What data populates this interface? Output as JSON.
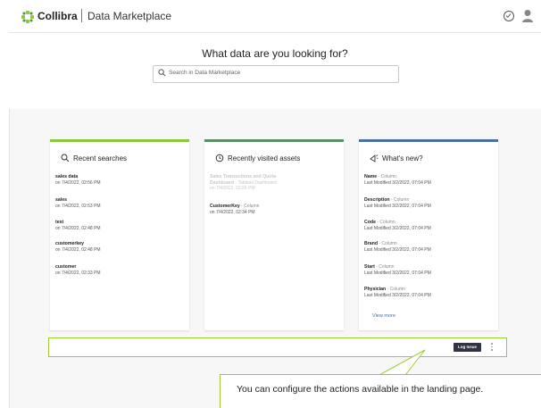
{
  "header": {
    "brand": "Collibra",
    "product": "Data Marketplace"
  },
  "hero": {
    "title": "What data are you looking for?",
    "search_placeholder": "Search in Data Marketplace"
  },
  "recent_searches": {
    "title": "Recent searches",
    "accent": "#8dc63f",
    "items": [
      {
        "name": "sales data",
        "meta": "on 7/4/2022, 02:56 PM"
      },
      {
        "name": "sales",
        "meta": "on 7/4/2022, 02:53 PM"
      },
      {
        "name": "test",
        "meta": "on 7/4/2022, 02:48 PM"
      },
      {
        "name": "customerkey",
        "meta": "on 7/4/2022, 02:48 PM"
      },
      {
        "name": "customer",
        "meta": "on 7/4/2022, 02:33 PM"
      }
    ]
  },
  "recently_visited": {
    "title": "Recently visited assets",
    "accent": "#5a8f69",
    "items": [
      {
        "name": "Sales Transactions and Quota Dashboard",
        "type": " - Tableau Dashboard",
        "meta": "on 7/4/2022, 02:56 PM"
      },
      {
        "name": "CustomerKey",
        "type": " - Column",
        "meta": "on 7/4/2022, 02:34 PM"
      }
    ]
  },
  "whats_new": {
    "title": "What's new?",
    "accent": "#4a6ea9",
    "items": [
      {
        "name": "Name",
        "type": " - Column",
        "meta": "Last Modified 3/2/2022, 07:04 PM"
      },
      {
        "name": "Description",
        "type": " - Column",
        "meta": "Last Modified 3/2/2022, 07:04 PM"
      },
      {
        "name": "Code",
        "type": " - Column",
        "meta": "Last Modified 3/2/2022, 07:04 PM"
      },
      {
        "name": "Brand",
        "type": " - Column",
        "meta": "Last Modified 3/2/2022, 07:04 PM"
      },
      {
        "name": "Start",
        "type": " - Column",
        "meta": "Last Modified 3/2/2022, 07:04 PM"
      },
      {
        "name": "Physician",
        "type": " - Column",
        "meta": "Last Modified 3/2/2022, 07:04 PM"
      }
    ],
    "view_more": "View more"
  },
  "actions": {
    "log_issue": "Log Issue"
  },
  "callout": {
    "text": "You can configure the actions available in the landing page.",
    "border_color": "#99cc33"
  },
  "icons": [
    "collibra-logo-icon",
    "check-circle-icon",
    "user-avatar-icon",
    "search-icon",
    "clock-history-icon",
    "megaphone-icon",
    "kebab-menu-icon"
  ]
}
